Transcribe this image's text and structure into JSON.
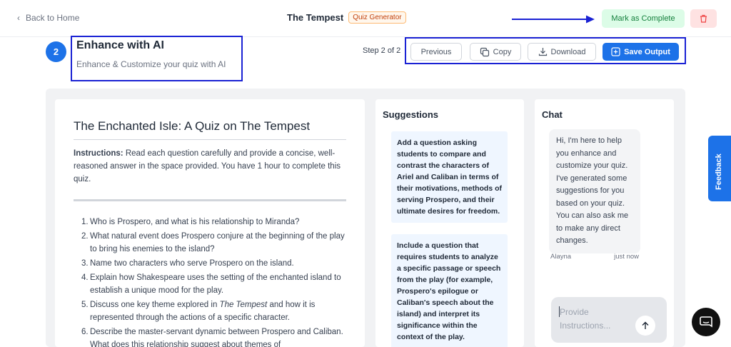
{
  "header": {
    "back_label": "Back to Home",
    "title": "The Tempest",
    "badge": "Quiz Generator",
    "mark_complete_label": "Mark as Complete",
    "accent_color": "#1d72e8"
  },
  "step": {
    "number": "2",
    "heading": "Enhance with AI",
    "subheading": "Enhance & Customize your quiz with AI",
    "progress_text": "Step 2 of 2"
  },
  "toolbar": {
    "previous_label": "Previous",
    "copy_label": "Copy",
    "download_label": "Download",
    "save_label": "Save Output"
  },
  "document": {
    "title": "The Enchanted Isle: A Quiz on The Tempest",
    "instructions_label": "Instructions:",
    "instructions_text": " Read each question carefully and provide a concise, well-reasoned answer in the space provided. You have 1 hour to complete this quiz.",
    "questions": [
      {
        "num": "1.",
        "pre": "Who is Prospero, and what is his relationship to Miranda?",
        "em": "",
        "post": ""
      },
      {
        "num": "2.",
        "pre": "What natural event does Prospero conjure at the beginning of the play to bring his enemies to the island?",
        "em": "",
        "post": ""
      },
      {
        "num": "3.",
        "pre": "Name two characters who serve Prospero on the island.",
        "em": "",
        "post": ""
      },
      {
        "num": "4.",
        "pre": "Explain how Shakespeare uses the setting of the enchanted island to establish a unique mood for the play.",
        "em": "",
        "post": ""
      },
      {
        "num": "5.",
        "pre": "Discuss one key theme explored in ",
        "em": "The Tempest",
        "post": " and how it is represented through the actions of a specific character."
      },
      {
        "num": "6.",
        "pre": "Describe the master-servant dynamic between Prospero and Caliban. What does this relationship suggest about themes of",
        "em": "",
        "post": ""
      }
    ]
  },
  "suggestions": {
    "title": "Suggestions",
    "items": [
      "Add a question asking students to compare and contrast the characters of Ariel and Caliban in terms of their motivations, methods of serving Prospero, and their ultimate desires for freedom.",
      "Include a question that requires students to analyze a specific passage or speech from the play (for example, Prospero's epilogue or Caliban's speech about the island) and interpret its significance within the context of the play."
    ]
  },
  "chat": {
    "title": "Chat",
    "message": "Hi, I'm here to help you enhance and customize your quiz. I've generated some suggestions for you based on your quiz. You can also ask me to make any direct changes.",
    "sender": "Alayna",
    "time": "just now",
    "input_placeholder": "Provide Instructions..."
  },
  "feedback_label": "Feedback"
}
